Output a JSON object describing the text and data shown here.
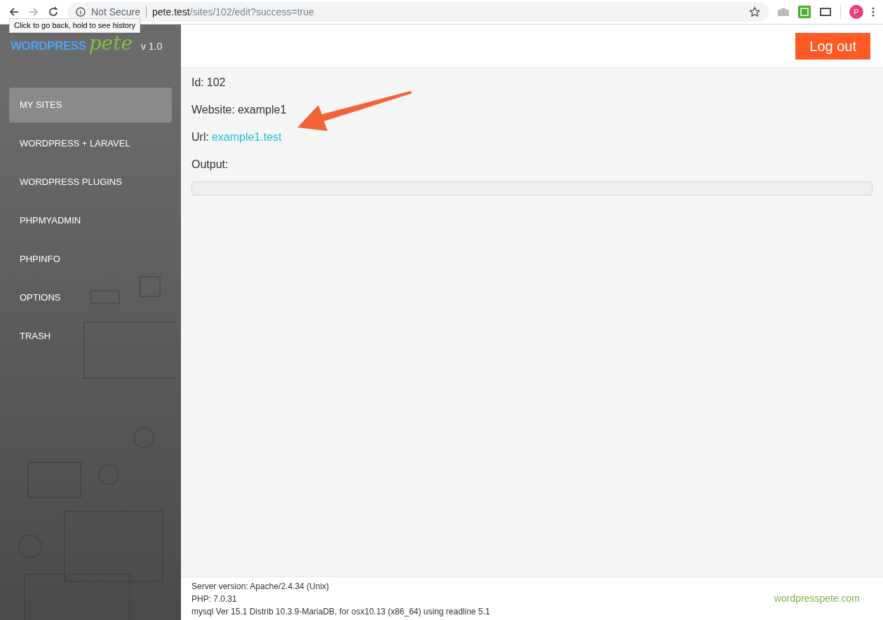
{
  "browser": {
    "security_label": "Not Secure",
    "url_host": "pete.test",
    "url_path": "/sites/102/edit?success=true",
    "tooltip": "Click to go back, hold to see history",
    "avatar_letter": "P"
  },
  "logo": {
    "word_1": "WORDPRESS",
    "word_2": "pete",
    "version": "v 1.0"
  },
  "sidebar": {
    "items": [
      {
        "label": "MY SITES",
        "selected": true
      },
      {
        "label": "WORDPRESS + LARAVEL",
        "selected": false
      },
      {
        "label": "WORDPRESS PLUGINS",
        "selected": false
      },
      {
        "label": "PHPMYADMIN",
        "selected": false
      },
      {
        "label": "PHPINFO",
        "selected": false
      },
      {
        "label": "OPTIONS",
        "selected": false
      },
      {
        "label": "TRASH",
        "selected": false
      }
    ]
  },
  "header": {
    "logout_button": "Log out"
  },
  "details": [
    {
      "kind": "text",
      "label": "Id:",
      "value": "102"
    },
    {
      "kind": "text",
      "label": "Website:",
      "value": "example1"
    },
    {
      "kind": "link",
      "label": "Url:",
      "value": "example1.test"
    },
    {
      "kind": "output",
      "label": "Output:"
    }
  ],
  "footer": {
    "lines": [
      "Server version: Apache/2.4.34 (Unix)",
      "PHP: 7.0.31",
      "mysql Ver 15.1 Distrib 10.3.9-MariaDB, for osx10.13 (x86_64) using readline 5.1"
    ],
    "link": "wordpresspete.com"
  }
}
